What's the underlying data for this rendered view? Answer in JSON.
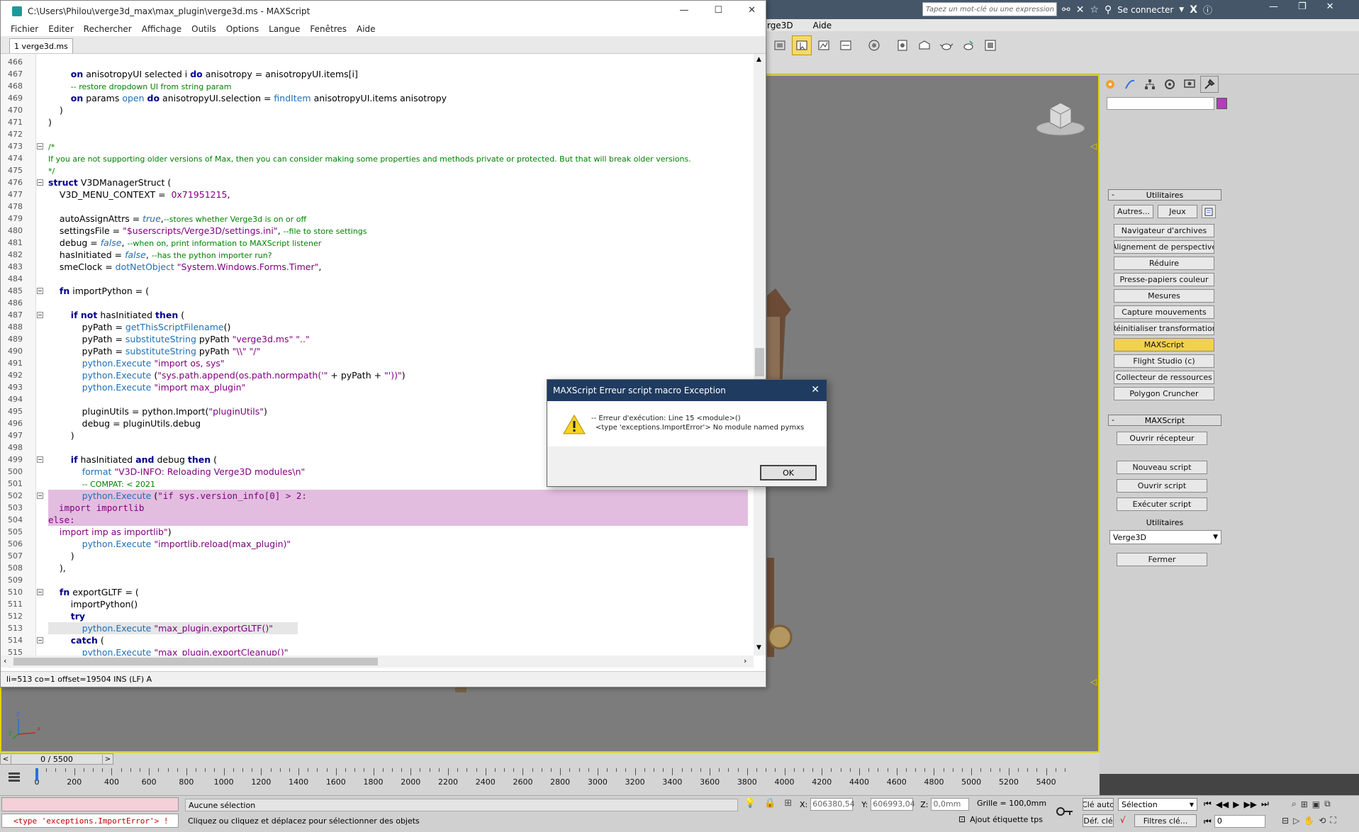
{
  "max": {
    "search_placeholder": "Tapez un mot-clé ou une expression",
    "connect_label": "Se connecter",
    "menu": [
      "rge3D",
      "Aide"
    ],
    "command_panel": {
      "utilities_header": "Utilitaires",
      "buttons_row": [
        "Autres...",
        "Jeux"
      ],
      "utilities": [
        "Navigateur d'archives",
        "Alignement de perspective",
        "Réduire",
        "Presse-papiers couleur",
        "Mesures",
        "Capture mouvements",
        "Réinitialiser transformation",
        "MAXScript",
        "Flight Studio (c)",
        "Collecteur de ressources",
        "Polygon Cruncher"
      ],
      "active_utility": "MAXScript",
      "maxscript_header": "MAXScript",
      "maxscript_buttons": [
        "Ouvrir récepteur",
        "Nouveau script",
        "Ouvrir script",
        "Exécuter script"
      ],
      "utilities_label": "Utilitaires",
      "dropdown_value": "Verge3D",
      "close_label": "Fermer"
    },
    "timeline": {
      "frame_label": "0 / 5500",
      "ticks": [
        "0",
        "200",
        "400",
        "600",
        "800",
        "1000",
        "1200",
        "1400",
        "1600",
        "1800",
        "2000",
        "2200",
        "2400",
        "2600",
        "2800",
        "3000",
        "3200",
        "3400",
        "3600",
        "3800",
        "4000",
        "4200",
        "4400",
        "4600",
        "4800",
        "5000",
        "5200",
        "5400"
      ]
    },
    "status": {
      "error_text": "<type 'exceptions.ImportError'> !",
      "selection_text": "Aucune sélection",
      "hint_text": "Cliquez ou cliquez et déplacez pour sélectionner des objets",
      "x_label": "X:",
      "x_value": "606380,54",
      "y_label": "Y:",
      "y_value": "606993,04",
      "z_label": "Z:",
      "z_value": "0,0mm",
      "grid_text": "Grille = 100,0mm",
      "add_tag": "Ajout étiquette tps",
      "auto_key": "Clé auto",
      "set_key": "Déf. clé",
      "selection_dropdown": "Sélection",
      "filters": "Filtres clé...",
      "frame_value": "0"
    }
  },
  "editor": {
    "title": "C:\\Users\\Philou\\verge3d_max\\max_plugin\\verge3d.ms - MAXScript",
    "menu": [
      "Fichier",
      "Editer",
      "Rechercher",
      "Affichage",
      "Outils",
      "Options",
      "Langue",
      "Fenêtres",
      "Aide"
    ],
    "tab_label": "1 verge3d.ms",
    "status_text": "li=513 co=1 offset=19504 INS (LF) A",
    "lines": [
      {
        "n": "466",
        "folded": false,
        "segs": []
      },
      {
        "n": "467",
        "folded": false,
        "segs": [
          {
            "c": "",
            "t": "        "
          },
          {
            "c": "kw",
            "t": "on"
          },
          {
            "c": "",
            "t": " anisotropyUI selected i "
          },
          {
            "c": "kw",
            "t": "do"
          },
          {
            "c": "",
            "t": " anisotropy = anisotropyUI.items[i]"
          }
        ]
      },
      {
        "n": "468",
        "folded": false,
        "segs": [
          {
            "c": "",
            "t": "        "
          },
          {
            "c": "cm",
            "t": "-- restore dropdown UI from string param"
          }
        ]
      },
      {
        "n": "469",
        "folded": false,
        "segs": [
          {
            "c": "",
            "t": "        "
          },
          {
            "c": "kw",
            "t": "on"
          },
          {
            "c": "",
            "t": " params "
          },
          {
            "c": "fn",
            "t": "open"
          },
          {
            "c": "",
            "t": " "
          },
          {
            "c": "kw",
            "t": "do"
          },
          {
            "c": "",
            "t": " anisotropyUI.selection = "
          },
          {
            "c": "fn",
            "t": "findItem"
          },
          {
            "c": "",
            "t": " anisotropyUI.items anisotropy"
          }
        ]
      },
      {
        "n": "470",
        "folded": false,
        "segs": [
          {
            "c": "",
            "t": "    )"
          }
        ]
      },
      {
        "n": "471",
        "folded": false,
        "segs": [
          {
            "c": "",
            "t": ")"
          }
        ]
      },
      {
        "n": "472",
        "folded": false,
        "segs": []
      },
      {
        "n": "473",
        "folded": true,
        "segs": [
          {
            "c": "cm",
            "t": "/*"
          }
        ]
      },
      {
        "n": "474",
        "folded": false,
        "segs": [
          {
            "c": "cm",
            "t": "If you are not supporting older versions of Max, then you can consider making some properties and methods private or protected. But that will break older versions."
          }
        ]
      },
      {
        "n": "475",
        "folded": false,
        "segs": [
          {
            "c": "cm",
            "t": "*/"
          }
        ]
      },
      {
        "n": "476",
        "folded": true,
        "segs": [
          {
            "c": "kw",
            "t": "struct"
          },
          {
            "c": "",
            "t": " V3DManagerStruct ("
          }
        ]
      },
      {
        "n": "477",
        "folded": false,
        "segs": [
          {
            "c": "",
            "t": "    V3D_MENU_CONTEXT =  "
          },
          {
            "c": "num",
            "t": "0x71951215"
          },
          {
            "c": "",
            "t": ","
          }
        ]
      },
      {
        "n": "478",
        "folded": false,
        "segs": []
      },
      {
        "n": "479",
        "folded": false,
        "segs": [
          {
            "c": "",
            "t": "    autoAssignAttrs = "
          },
          {
            "c": "ital",
            "t": "true"
          },
          {
            "c": "",
            "t": ","
          },
          {
            "c": "cm",
            "t": "--stores whether Verge3d is on or off"
          }
        ]
      },
      {
        "n": "480",
        "folded": false,
        "segs": [
          {
            "c": "",
            "t": "    settingsFile = "
          },
          {
            "c": "str",
            "t": "\"$userscripts/Verge3D/settings.ini\""
          },
          {
            "c": "",
            "t": ", "
          },
          {
            "c": "cm",
            "t": "--file to store settings"
          }
        ]
      },
      {
        "n": "481",
        "folded": false,
        "segs": [
          {
            "c": "",
            "t": "    debug = "
          },
          {
            "c": "ital",
            "t": "false"
          },
          {
            "c": "",
            "t": ", "
          },
          {
            "c": "cm",
            "t": "--when on, print information to MAXScript listener"
          }
        ]
      },
      {
        "n": "482",
        "folded": false,
        "segs": [
          {
            "c": "",
            "t": "    hasInitiated = "
          },
          {
            "c": "ital",
            "t": "false"
          },
          {
            "c": "",
            "t": ", "
          },
          {
            "c": "cm",
            "t": "--has the python importer run?"
          }
        ]
      },
      {
        "n": "483",
        "folded": false,
        "segs": [
          {
            "c": "",
            "t": "    smeClock = "
          },
          {
            "c": "fn",
            "t": "dotNetObject"
          },
          {
            "c": "",
            "t": " "
          },
          {
            "c": "str",
            "t": "\"System.Windows.Forms.Timer\""
          },
          {
            "c": "",
            "t": ","
          }
        ]
      },
      {
        "n": "484",
        "folded": false,
        "segs": []
      },
      {
        "n": "485",
        "folded": true,
        "segs": [
          {
            "c": "",
            "t": "    "
          },
          {
            "c": "kw",
            "t": "fn"
          },
          {
            "c": "",
            "t": " importPython = ("
          }
        ]
      },
      {
        "n": "486",
        "folded": false,
        "segs": []
      },
      {
        "n": "487",
        "folded": true,
        "segs": [
          {
            "c": "",
            "t": "        "
          },
          {
            "c": "kw",
            "t": "if not"
          },
          {
            "c": "",
            "t": " hasInitiated "
          },
          {
            "c": "kw",
            "t": "then"
          },
          {
            "c": "",
            "t": " ("
          }
        ]
      },
      {
        "n": "488",
        "folded": false,
        "segs": [
          {
            "c": "",
            "t": "            pyPath = "
          },
          {
            "c": "fn",
            "t": "getThisScriptFilename"
          },
          {
            "c": "",
            "t": "()"
          }
        ]
      },
      {
        "n": "489",
        "folded": false,
        "segs": [
          {
            "c": "",
            "t": "            pyPath = "
          },
          {
            "c": "fn",
            "t": "substituteString"
          },
          {
            "c": "",
            "t": " pyPath "
          },
          {
            "c": "str",
            "t": "\"verge3d.ms\" \"..\""
          }
        ]
      },
      {
        "n": "490",
        "folded": false,
        "segs": [
          {
            "c": "",
            "t": "            pyPath = "
          },
          {
            "c": "fn",
            "t": "substituteString"
          },
          {
            "c": "",
            "t": " pyPath "
          },
          {
            "c": "str",
            "t": "\"\\\\\" \"/\""
          }
        ]
      },
      {
        "n": "491",
        "folded": false,
        "segs": [
          {
            "c": "",
            "t": "            "
          },
          {
            "c": "fn",
            "t": "python.Execute"
          },
          {
            "c": "",
            "t": " "
          },
          {
            "c": "str",
            "t": "\"import os, sys\""
          }
        ]
      },
      {
        "n": "492",
        "folded": false,
        "segs": [
          {
            "c": "",
            "t": "            "
          },
          {
            "c": "fn",
            "t": "python.Execute"
          },
          {
            "c": "",
            "t": " ("
          },
          {
            "c": "str",
            "t": "\"sys.path.append(os.path.normpath('\""
          },
          {
            "c": "",
            "t": " + pyPath + "
          },
          {
            "c": "str",
            "t": "\"'))\""
          },
          {
            "c": "",
            "t": ")"
          }
        ]
      },
      {
        "n": "493",
        "folded": false,
        "segs": [
          {
            "c": "",
            "t": "            "
          },
          {
            "c": "fn",
            "t": "python.Execute"
          },
          {
            "c": "",
            "t": " "
          },
          {
            "c": "str",
            "t": "\"import max_plugin\""
          }
        ]
      },
      {
        "n": "494",
        "folded": false,
        "segs": []
      },
      {
        "n": "495",
        "folded": false,
        "segs": [
          {
            "c": "",
            "t": "            pluginUtils = python.Import("
          },
          {
            "c": "str",
            "t": "\"pluginUtils\""
          },
          {
            "c": "",
            "t": ")"
          }
        ]
      },
      {
        "n": "496",
        "folded": false,
        "segs": [
          {
            "c": "",
            "t": "            debug = pluginUtils.debug"
          }
        ]
      },
      {
        "n": "497",
        "folded": false,
        "segs": [
          {
            "c": "",
            "t": "        )"
          }
        ]
      },
      {
        "n": "498",
        "folded": false,
        "segs": []
      },
      {
        "n": "499",
        "folded": true,
        "segs": [
          {
            "c": "",
            "t": "        "
          },
          {
            "c": "kw",
            "t": "if"
          },
          {
            "c": "",
            "t": " hasInitiated "
          },
          {
            "c": "kw",
            "t": "and"
          },
          {
            "c": "",
            "t": " debug "
          },
          {
            "c": "kw",
            "t": "then"
          },
          {
            "c": "",
            "t": " ("
          }
        ]
      },
      {
        "n": "500",
        "folded": false,
        "segs": [
          {
            "c": "",
            "t": "            "
          },
          {
            "c": "fn",
            "t": "format"
          },
          {
            "c": "",
            "t": " "
          },
          {
            "c": "str",
            "t": "\"V3D-INFO: Reloading Verge3D modules\\n\""
          }
        ]
      },
      {
        "n": "501",
        "folded": false,
        "segs": [
          {
            "c": "",
            "t": "            "
          },
          {
            "c": "cm",
            "t": "-- COMPAT: < 2021"
          }
        ]
      },
      {
        "n": "502",
        "folded": true,
        "hl": true,
        "segs": [
          {
            "c": "",
            "t": "            "
          },
          {
            "c": "fn",
            "t": "python.Execute"
          },
          {
            "c": "",
            "t": " ("
          },
          {
            "c": "str mono",
            "t": "\"if sys.version_info[0] > 2:"
          }
        ]
      },
      {
        "n": "503",
        "folded": false,
        "hl": true,
        "segs": [
          {
            "c": "str mono",
            "t": "  import importlib"
          }
        ]
      },
      {
        "n": "504",
        "folded": false,
        "hl": true,
        "segs": [
          {
            "c": "str mono",
            "t": "else:"
          }
        ]
      },
      {
        "n": "505",
        "folded": false,
        "segs": [
          {
            "c": "str",
            "t": "    import imp as importlib\""
          },
          {
            "c": "",
            "t": ")"
          }
        ]
      },
      {
        "n": "506",
        "folded": false,
        "segs": [
          {
            "c": "",
            "t": "            "
          },
          {
            "c": "fn",
            "t": "python.Execute"
          },
          {
            "c": "",
            "t": " "
          },
          {
            "c": "str",
            "t": "\"importlib.reload(max_plugin)\""
          }
        ]
      },
      {
        "n": "507",
        "folded": false,
        "segs": [
          {
            "c": "",
            "t": "        )"
          }
        ]
      },
      {
        "n": "508",
        "folded": false,
        "segs": [
          {
            "c": "",
            "t": "    ),"
          }
        ]
      },
      {
        "n": "509",
        "folded": false,
        "segs": []
      },
      {
        "n": "510",
        "folded": true,
        "segs": [
          {
            "c": "",
            "t": "    "
          },
          {
            "c": "kw",
            "t": "fn"
          },
          {
            "c": "",
            "t": " exportGLTF = ("
          }
        ]
      },
      {
        "n": "511",
        "folded": false,
        "segs": [
          {
            "c": "",
            "t": "        importPython()"
          }
        ]
      },
      {
        "n": "512",
        "folded": false,
        "segs": [
          {
            "c": "",
            "t": "        "
          },
          {
            "c": "kw",
            "t": "try"
          }
        ]
      },
      {
        "n": "513",
        "folded": false,
        "cur": true,
        "segs": [
          {
            "c": "",
            "t": "            "
          },
          {
            "c": "fn",
            "t": "python.Execute"
          },
          {
            "c": "",
            "t": " "
          },
          {
            "c": "str",
            "t": "\"max_plugin.exportGLTF()\""
          }
        ]
      },
      {
        "n": "514",
        "folded": true,
        "segs": [
          {
            "c": "",
            "t": "        "
          },
          {
            "c": "kw",
            "t": "catch"
          },
          {
            "c": "",
            "t": " ("
          }
        ]
      },
      {
        "n": "515",
        "folded": false,
        "segs": [
          {
            "c": "",
            "t": "            "
          },
          {
            "c": "fn",
            "t": "python.Execute"
          },
          {
            "c": "",
            "t": " "
          },
          {
            "c": "str",
            "t": "\"max_plugin.exportCleanup()\""
          }
        ]
      }
    ]
  },
  "dialog": {
    "title": "MAXScript Erreur script macro Exception",
    "line1": "-- Erreur d'exécution:  Line 15  <module>()",
    "line2": "<type 'exceptions.ImportError'> No module named pymxs",
    "ok_label": "OK"
  },
  "colors": {
    "viewport_border": "#e2d400",
    "highlight": "#e3bde0",
    "active_button": "#f2d14c",
    "dialog_title": "#1f3b60"
  }
}
